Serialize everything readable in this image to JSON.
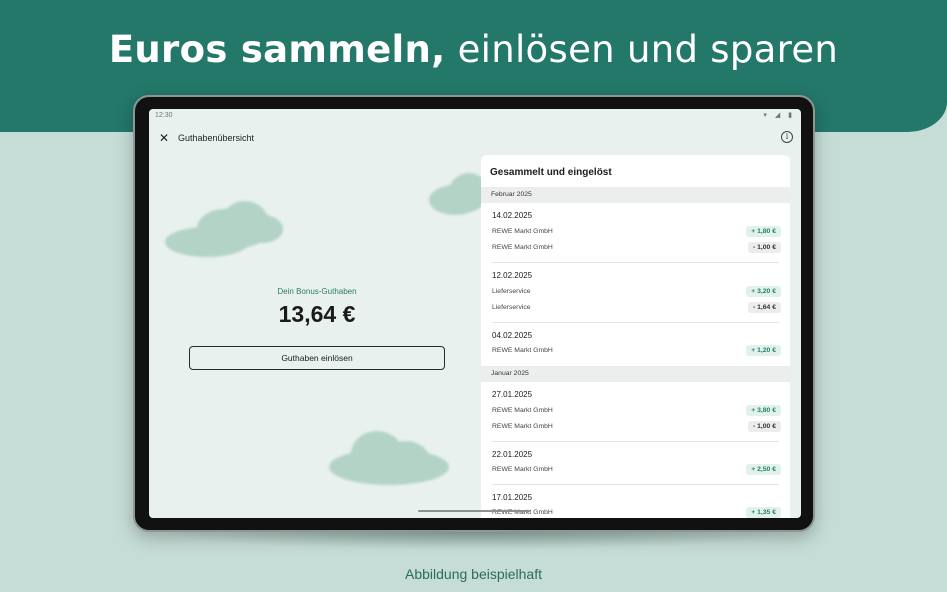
{
  "headline": {
    "bold": "Euros sammeln,",
    "light": " einlösen und sparen"
  },
  "statusbar": {
    "time": "12:30",
    "icons": "▾ ◢ ▮"
  },
  "appbar": {
    "close_icon": "✕",
    "title": "Guthabenübersicht",
    "info_icon": "i"
  },
  "bonus": {
    "label": "Dein Bonus-Guthaben",
    "amount": "13,64 €",
    "redeem_button": "Guthaben einlösen"
  },
  "panel": {
    "title": "Gesammelt und eingelöst",
    "months": [
      "Februar 2025",
      "Januar 2025"
    ],
    "entries": [
      {
        "date": "14.02.2025",
        "rows": [
          {
            "label": "REWE Markt GmbH",
            "amount": "+ 1,80 €",
            "kind": "plus"
          },
          {
            "label": "REWE Markt GmbH",
            "amount": "- 1,00 €",
            "kind": "minus"
          }
        ]
      },
      {
        "date": "12.02.2025",
        "rows": [
          {
            "label": "Lieferservice",
            "amount": "+ 3,20 €",
            "kind": "plus"
          },
          {
            "label": "Lieferservice",
            "amount": "- 1,64 €",
            "kind": "minus"
          }
        ]
      },
      {
        "date": "04.02.2025",
        "rows": [
          {
            "label": "REWE Markt GmbH",
            "amount": "+ 1,20 €",
            "kind": "plus"
          }
        ]
      },
      {
        "date": "27.01.2025",
        "rows": [
          {
            "label": "REWE Markt GmbH",
            "amount": "+ 3,80 €",
            "kind": "plus"
          },
          {
            "label": "REWE Markt GmbH",
            "amount": "- 1,00 €",
            "kind": "minus"
          }
        ]
      },
      {
        "date": "22.01.2025",
        "rows": [
          {
            "label": "REWE Markt GmbH",
            "amount": "+ 2,50 €",
            "kind": "plus"
          }
        ]
      },
      {
        "date": "17.01.2025",
        "rows": [
          {
            "label": "REWE Markt GmbH",
            "amount": "+ 1,35 €",
            "kind": "plus"
          }
        ]
      }
    ]
  },
  "footnote": "Abbildung beispielhaft",
  "colors": {
    "brand": "#23786a",
    "background": "#c6ddd7",
    "plus_text": "#22806b",
    "plus_bg": "#e2f1ec"
  }
}
